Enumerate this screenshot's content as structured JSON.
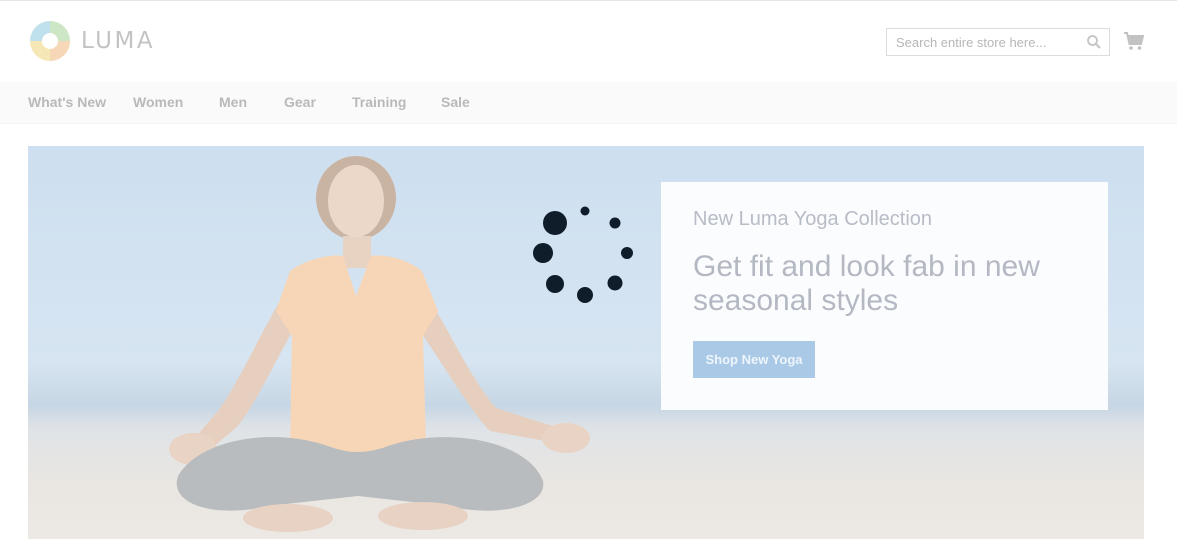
{
  "brand": {
    "name": "LUMA"
  },
  "search": {
    "placeholder": "Search entire store here...",
    "value": ""
  },
  "icons": {
    "search": "search-icon",
    "cart": "cart-icon",
    "loader": "loading-spinner-icon"
  },
  "nav": {
    "items": [
      {
        "label": "What's New"
      },
      {
        "label": "Women"
      },
      {
        "label": "Men"
      },
      {
        "label": "Gear"
      },
      {
        "label": "Training"
      },
      {
        "label": "Sale"
      }
    ]
  },
  "hero": {
    "subtitle": "New Luma Yoga Collection",
    "title": "Get fit and look fab in new seasonal styles",
    "button_label": "Shop New Yoga"
  },
  "colors": {
    "accent": "#a9c9e6",
    "overlay": "#ffffff",
    "spinner": "#0f1c2a",
    "nav_text": "#b9b9b9"
  }
}
